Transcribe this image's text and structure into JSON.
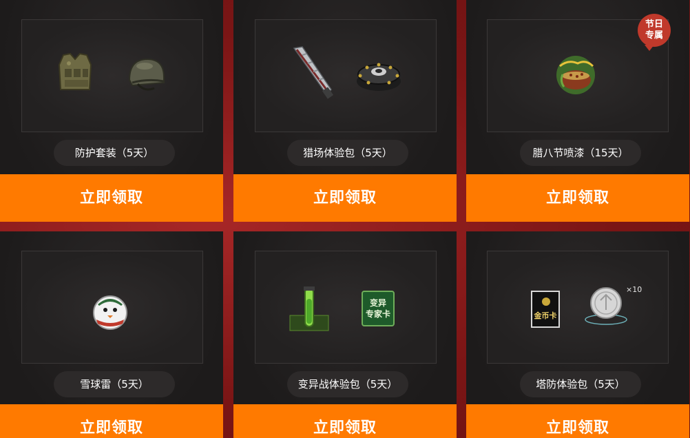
{
  "cards": [
    {
      "name": "防护套装（5天）",
      "button": "立即领取",
      "items": [
        "body-armor-icon",
        "helmet-icon"
      ]
    },
    {
      "name": "猎场体验包（5天）",
      "button": "立即领取",
      "items": [
        "blade-weapon-icon",
        "landmine-icon"
      ]
    },
    {
      "name": "腊八节喷漆（15天）",
      "button": "立即领取",
      "items": [
        "laba-spray-icon"
      ],
      "badge": [
        "节日",
        "专属"
      ]
    },
    {
      "name": "雪球雷（5天）",
      "button": "立即领取",
      "items": [
        "snowball-grenade-icon"
      ]
    },
    {
      "name": "变异战体验包（5天）",
      "button": "立即领取",
      "items": [
        "mutant-vial-icon",
        "mutant-expert-card-icon"
      ],
      "card_label": [
        "变异",
        "专家卡"
      ]
    },
    {
      "name": "塔防体验包（5天）",
      "button": "立即领取",
      "items": [
        "gold-coin-card-icon",
        "silver-coin-icon"
      ],
      "card_label": [
        "金币卡"
      ],
      "coin_multiplier": "×10"
    }
  ],
  "colors": {
    "claim_button": "#ff7a00",
    "card_bg": "#1d1b1b",
    "page_bg": "#8e1d1d",
    "badge": "#c0392b"
  }
}
